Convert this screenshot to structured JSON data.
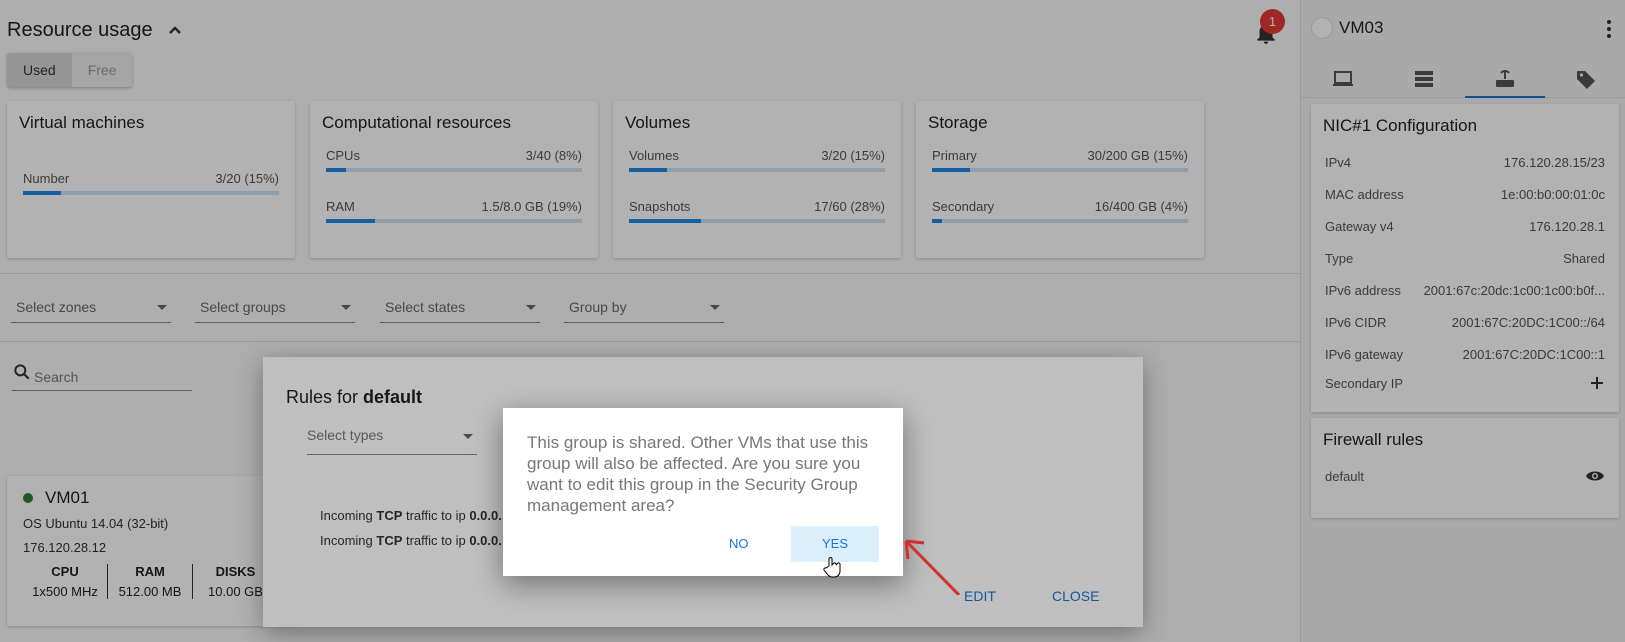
{
  "header": {
    "title": "Resource usage",
    "toggle": [
      "Used",
      "Free"
    ],
    "notifications": "1"
  },
  "cards": {
    "vm": {
      "title": "Virtual machines",
      "rows": [
        {
          "label": "Number",
          "value": "3/20 (15%)",
          "pct": 15
        }
      ]
    },
    "compute": {
      "title": "Computational resources",
      "rows": [
        {
          "label": "CPUs",
          "value": "3/40 (8%)",
          "pct": 8
        },
        {
          "label": "RAM",
          "value": "1.5/8.0 GB (19%)",
          "pct": 19
        }
      ]
    },
    "volumes": {
      "title": "Volumes",
      "rows": [
        {
          "label": "Volumes",
          "value": "3/20 (15%)",
          "pct": 15
        },
        {
          "label": "Snapshots",
          "value": "17/60 (28%)",
          "pct": 28
        }
      ]
    },
    "storage": {
      "title": "Storage",
      "rows": [
        {
          "label": "Primary",
          "value": "30/200 GB (15%)",
          "pct": 15
        },
        {
          "label": "Secondary",
          "value": "16/400 GB (4%)",
          "pct": 4
        }
      ]
    }
  },
  "filters": {
    "zones": "Select zones",
    "groups": "Select groups",
    "states": "Select states",
    "groupby": "Group by",
    "search": "Search"
  },
  "vmcard": {
    "name": "VM01",
    "os": "OS Ubuntu 14.04 (32-bit)",
    "ip": "176.120.28.12",
    "stats": [
      {
        "k": "CPU",
        "v": "1x500 MHz"
      },
      {
        "k": "RAM",
        "v": "512.00 MB"
      },
      {
        "k": "DISKS",
        "v": "10.00 GB"
      }
    ]
  },
  "side": {
    "vm": "VM03",
    "nic_title": "NIC#1 Configuration",
    "nic": [
      {
        "k": "IPv4",
        "v": "176.120.28.15/23"
      },
      {
        "k": "MAC address",
        "v": "1e:00:b0:00:01:0c"
      },
      {
        "k": "Gateway v4",
        "v": "176.120.28.1"
      },
      {
        "k": "Type",
        "v": "Shared"
      },
      {
        "k": "IPv6 address",
        "v": "2001:67c:20dc:1c00:1c00:b0f..."
      },
      {
        "k": "IPv6 CIDR",
        "v": "2001:67C:20DC:1C00::/64"
      },
      {
        "k": "IPv6 gateway",
        "v": "2001:67C:20DC:1C00::1"
      }
    ],
    "secondary_ip": "Secondary IP",
    "fw_title": "Firewall rules",
    "fw_item": "default"
  },
  "rules_dialog": {
    "title_prefix": "Rules for ",
    "title_bold": "default",
    "select_types": "Select types",
    "rule_prefix": "Incoming ",
    "rule_proto": "TCP",
    "rule_mid": " traffic to ip ",
    "rule_ip": "0.0.0.",
    "edit": "EDIT",
    "close": "CLOSE"
  },
  "confirm": {
    "message": "This group is shared. Other VMs that use this group will also be affected. Are you sure you want to edit this group in the Security Group management area?",
    "no": "NO",
    "yes": "YES"
  },
  "colors": {
    "accent": "#1976d2",
    "bar_fill": "#1e88e5",
    "badge": "#e53935",
    "annotation_arrow": "#d32f2f"
  }
}
